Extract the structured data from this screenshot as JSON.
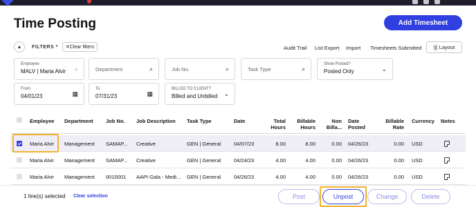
{
  "header": {
    "title": "Time Posting",
    "add_button": "Add Timesheet"
  },
  "filters": {
    "toggle_label": "FILTERS *",
    "clear_label": "Clear filters",
    "links": [
      "Audit Trail",
      "List Export",
      "Import",
      "Timesheets Submitted"
    ],
    "layout_label": "Layout",
    "employee": {
      "label": "Employee",
      "value": "MALV | Maria Alvir"
    },
    "department": {
      "placeholder": "Department"
    },
    "job_no": {
      "placeholder": "Job No."
    },
    "task_type": {
      "placeholder": "Task Type"
    },
    "show_posted": {
      "label": "Show Posted?",
      "value": "Posted Only"
    },
    "from": {
      "label": "From",
      "value": "04/01/23"
    },
    "to": {
      "label": "To",
      "value": "07/31/23"
    },
    "billed": {
      "label": "BILLED TO CLIENT?",
      "value": "Billed and Unbilled"
    }
  },
  "table": {
    "columns": {
      "employee": "Employee",
      "department": "Department",
      "job_no": "Job No.",
      "job_description": "Job Description",
      "task_type": "Task Type",
      "date": "Date",
      "total_hours_1": "Total",
      "total_hours_2": "Hours",
      "billable_hours_1": "Billable",
      "billable_hours_2": "Hours",
      "non_billable_1": "Non",
      "non_billable_2": "Billa...",
      "date_posted_1": "Date",
      "date_posted_2": "Posted",
      "billable_rate_1": "Billable",
      "billable_rate_2": "Rate",
      "currency": "Currency",
      "notes": "Notes"
    },
    "rows": [
      {
        "checked": true,
        "employee": "Maria Alvir",
        "department": "Management",
        "job_no": "SAMAP...",
        "job_description": "Creative",
        "task_type": "GEN | General",
        "date": "04/07/23",
        "total_hours": "8.00",
        "billable_hours": "8.00",
        "non_billable": "0.00",
        "date_posted": "04/26/23",
        "billable_rate": "0.00",
        "currency": "USD"
      },
      {
        "checked": false,
        "employee": "Maria Alvir",
        "department": "Management",
        "job_no": "SAMAP...",
        "job_description": "Creative",
        "task_type": "GEN | General",
        "date": "04/24/23",
        "total_hours": "4.00",
        "billable_hours": "4.00",
        "non_billable": "0.00",
        "date_posted": "04/26/23",
        "billable_rate": "0.00",
        "currency": "USD"
      },
      {
        "checked": false,
        "employee": "Maria Alvir",
        "department": "Management",
        "job_no": "0010001",
        "job_description": "AAPI Gala - Medi...",
        "task_type": "GEN | General",
        "date": "04/26/23",
        "total_hours": "4.00",
        "billable_hours": "4.00",
        "non_billable": "0.00",
        "date_posted": "04/26/23",
        "billable_rate": "0.00",
        "currency": "USD"
      }
    ]
  },
  "footer": {
    "selection_text": "1 line(s) selected",
    "clear_selection": "Clear selection",
    "post": "Post",
    "unpost": "Unpost",
    "change": "Change",
    "delete": "Delete"
  },
  "colors": {
    "accent": "#2f3fe0",
    "highlight": "#f2b32e",
    "topbar": "#1d1d2b"
  },
  "icons": [
    "search-icon",
    "calendar-icon",
    "chevron-down-icon",
    "notes-icon",
    "layout-icon",
    "close-icon",
    "collapse-icon"
  ]
}
